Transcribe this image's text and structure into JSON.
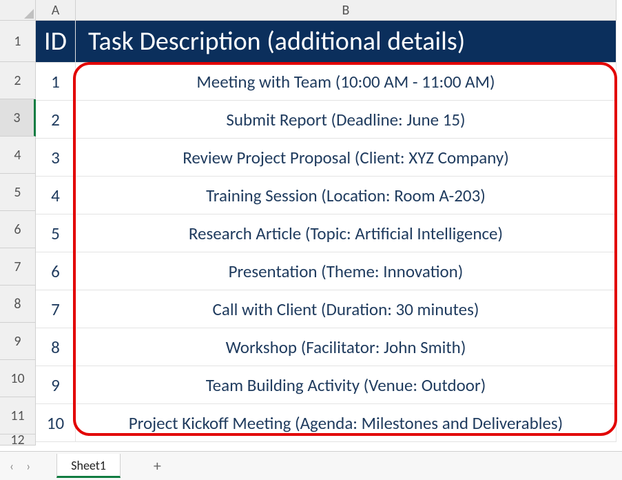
{
  "columns": {
    "A": "A",
    "B": "B"
  },
  "row_numbers": [
    "1",
    "2",
    "3",
    "4",
    "5",
    "6",
    "7",
    "8",
    "9",
    "10",
    "11",
    "12"
  ],
  "header": {
    "id": "ID",
    "task": "Task Description (additional details)"
  },
  "rows": [
    {
      "id": "1",
      "task": "Meeting with Team (10:00 AM - 11:00 AM)"
    },
    {
      "id": "2",
      "task": "Submit Report (Deadline: June 15)"
    },
    {
      "id": "3",
      "task": "Review Project Proposal (Client: XYZ Company)"
    },
    {
      "id": "4",
      "task": "Training Session (Location: Room A-203)"
    },
    {
      "id": "5",
      "task": "Research Article (Topic: Artificial Intelligence)"
    },
    {
      "id": "6",
      "task": "Presentation (Theme: Innovation)"
    },
    {
      "id": "7",
      "task": "Call with Client (Duration: 30 minutes)"
    },
    {
      "id": "8",
      "task": "Workshop (Facilitator: John Smith)"
    },
    {
      "id": "9",
      "task": "Team Building Activity (Venue: Outdoor)"
    },
    {
      "id": "10",
      "task": "Project Kickoff Meeting (Agenda: Milestones and Deliverables)"
    }
  ],
  "selected_row": "3",
  "sheet_tab": {
    "name": "Sheet1",
    "add": "+"
  },
  "nav": {
    "prev": "‹",
    "next": "›"
  },
  "chart_data": {
    "type": "table",
    "title": "Task Description (additional details)",
    "columns": [
      "ID",
      "Task Description (additional details)"
    ],
    "rows": [
      [
        "1",
        "Meeting with Team (10:00 AM - 11:00 AM)"
      ],
      [
        "2",
        "Submit Report (Deadline: June 15)"
      ],
      [
        "3",
        "Review Project Proposal (Client: XYZ Company)"
      ],
      [
        "4",
        "Training Session (Location: Room A-203)"
      ],
      [
        "5",
        "Research Article (Topic: Artificial Intelligence)"
      ],
      [
        "6",
        "Presentation (Theme: Innovation)"
      ],
      [
        "7",
        "Call with Client (Duration: 30 minutes)"
      ],
      [
        "8",
        "Workshop (Facilitator: John Smith)"
      ],
      [
        "9",
        "Team Building Activity (Venue: Outdoor)"
      ],
      [
        "10",
        "Project Kickoff Meeting (Agenda: Milestones and Deliverables)"
      ]
    ]
  }
}
